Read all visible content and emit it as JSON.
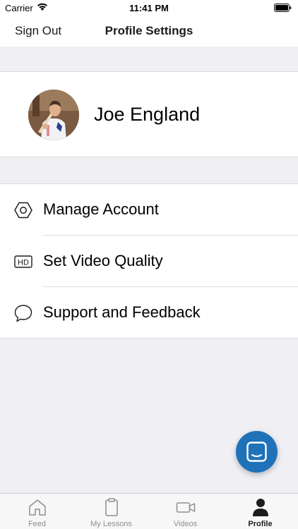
{
  "status_bar": {
    "carrier": "Carrier",
    "time": "11:41 PM"
  },
  "nav": {
    "sign_out_label": "Sign Out",
    "title": "Profile Settings"
  },
  "profile": {
    "name": "Joe England"
  },
  "menu": {
    "items": [
      {
        "label": "Manage Account",
        "icon": "hexagon-settings-icon"
      },
      {
        "label": "Set Video Quality",
        "icon": "hd-icon"
      },
      {
        "label": "Support and Feedback",
        "icon": "speech-bubble-icon"
      }
    ]
  },
  "fab": {
    "icon": "chat-icon",
    "color": "#1f72b8"
  },
  "tab_bar": {
    "tabs": [
      {
        "label": "Feed",
        "icon": "home-icon"
      },
      {
        "label": "My Lessons",
        "icon": "clipboard-icon"
      },
      {
        "label": "Videos",
        "icon": "video-camera-icon"
      },
      {
        "label": "Profile",
        "icon": "person-icon"
      }
    ],
    "active_index": 3,
    "active_color": "#1c1c1e",
    "inactive_color": "#8e8e93"
  }
}
